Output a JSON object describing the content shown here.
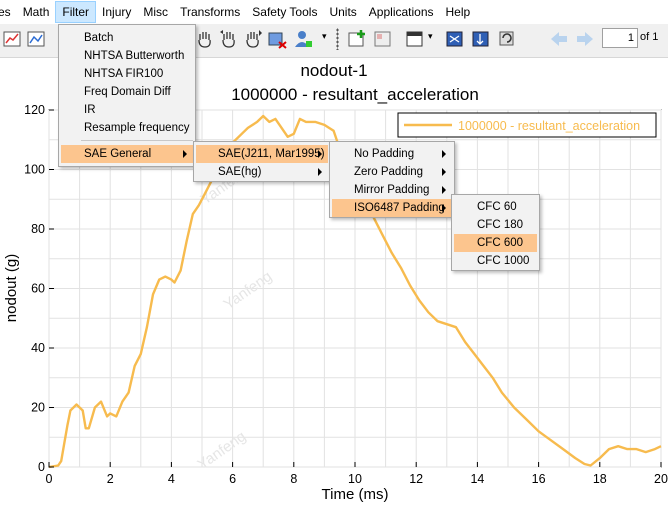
{
  "menubar": {
    "items": [
      "es",
      "Math",
      "Filter",
      "Injury",
      "Misc",
      "Transforms",
      "Safety Tools",
      "Units",
      "Applications",
      "Help"
    ],
    "active": "Filter"
  },
  "toolbar": {
    "page_current": "1",
    "page_total": "of 1"
  },
  "page_title": "nodout-1",
  "filter_menu": {
    "items": [
      "Batch",
      "NHTSA Butterworth",
      "NHTSA FIR100",
      "Freq Domain Diff",
      "IR",
      "Resample frequency",
      "SAE General"
    ]
  },
  "sae_general_menu": {
    "items": [
      "SAE(J211, Mar1995)",
      "SAE(hg)"
    ]
  },
  "sae_j211_menu": {
    "items": [
      "No Padding",
      "Zero Padding",
      "Mirror Padding",
      "ISO6487 Padding"
    ]
  },
  "iso_padding_menu": {
    "items": [
      "CFC 60",
      "CFC 180",
      "CFC 600",
      "CFC 1000"
    ],
    "highlighted": "CFC 600"
  },
  "watermark": "Yanfeng",
  "colors": {
    "curve": "#f7bb4e",
    "highlight": "#fcc58e",
    "menubar_active": "#cce8ff"
  },
  "chart_data": {
    "type": "line",
    "title": "1000000 - resultant_acceleration",
    "xlabel": "Time (ms)",
    "ylabel": "nodout (g)",
    "xlim": [
      0,
      20
    ],
    "ylim": [
      0,
      120
    ],
    "xticks": [
      0,
      2,
      4,
      6,
      8,
      10,
      12,
      14,
      16,
      18,
      20
    ],
    "yticks": [
      0,
      20,
      40,
      60,
      80,
      100,
      120
    ],
    "grid": true,
    "legend_position": "top-right",
    "series": [
      {
        "name": "1000000 - resultant_acceleration",
        "x": [
          0,
          0.3,
          0.4,
          0.5,
          0.6,
          0.7,
          0.9,
          1.1,
          1.2,
          1.3,
          1.5,
          1.7,
          1.9,
          2.0,
          2.2,
          2.4,
          2.6,
          2.8,
          3.0,
          3.2,
          3.4,
          3.6,
          3.8,
          4.0,
          4.1,
          4.3,
          4.5,
          4.7,
          4.9,
          5.1,
          5.3,
          5.5,
          5.7,
          5.9,
          6.1,
          6.3,
          6.5,
          6.8,
          7.0,
          7.2,
          7.4,
          7.6,
          7.8,
          8.0,
          8.2,
          8.4,
          8.7,
          9.0,
          9.3,
          9.5,
          9.8,
          10.0,
          10.3,
          10.6,
          10.9,
          11.2,
          11.5,
          11.8,
          12.1,
          12.4,
          12.7,
          13.0,
          13.3,
          13.6,
          13.9,
          14.2,
          14.5,
          14.8,
          15.2,
          15.6,
          16.0,
          16.4,
          16.8,
          17.2,
          17.5,
          17.7,
          18.0,
          18.3,
          18.6,
          18.9,
          19.2,
          19.5,
          19.8,
          20.0
        ],
        "values": [
          0,
          0.5,
          2,
          8,
          14,
          19,
          21,
          19,
          13,
          13,
          20,
          22,
          17,
          18,
          17,
          22,
          25,
          34,
          38,
          47,
          58,
          63,
          64,
          63,
          62,
          66,
          76,
          85,
          88,
          92,
          96,
          99,
          104,
          108,
          110,
          112,
          114,
          116,
          118,
          116,
          117,
          114,
          111,
          112,
          117,
          116,
          116,
          115,
          113,
          107,
          102,
          97,
          91,
          84,
          78,
          72,
          67,
          61,
          56,
          52,
          49,
          48,
          47,
          42,
          38,
          34,
          30,
          25,
          20,
          16,
          12,
          9,
          6,
          3,
          1,
          0.5,
          3,
          6,
          7,
          6,
          6,
          5,
          6,
          7
        ]
      }
    ]
  }
}
